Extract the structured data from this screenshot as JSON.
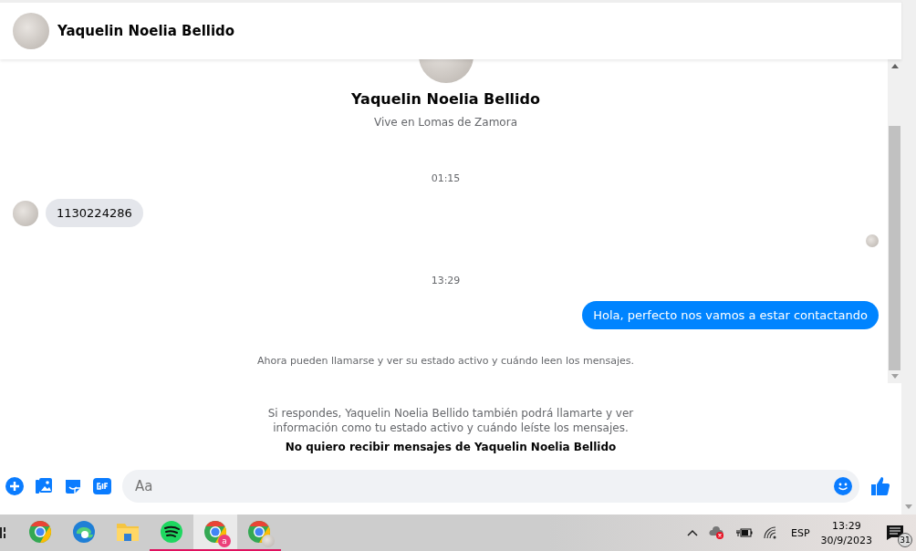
{
  "header": {
    "contact_name": "Yaquelin Noelia Bellido"
  },
  "profile": {
    "name": "Yaquelin Noelia Bellido",
    "subtitle": "Vive en Lomas de Zamora"
  },
  "messages": [
    {
      "kind": "time",
      "text": "01:15"
    },
    {
      "kind": "incoming",
      "text": "1130224286"
    },
    {
      "kind": "receipt"
    },
    {
      "kind": "time",
      "text": "13:29"
    },
    {
      "kind": "outgoing",
      "text": "Hola, perfecto nos vamos a estar contactando"
    },
    {
      "kind": "notice",
      "text": "Ahora pueden llamarse y ver su estado activo y cuándo leen los mensajes."
    }
  ],
  "request": {
    "text": "Si respondes, Yaquelin Noelia Bellido también podrá llamarte y ver información como tu estado activo y cuándo leíste los mensajes.",
    "link": "No quiero recibir mensajes de Yaquelin Noelia Bellido"
  },
  "composer": {
    "placeholder": "Aa"
  },
  "taskbar": {
    "apps": [
      {
        "kind": "chrome",
        "running": false,
        "selected": false
      },
      {
        "kind": "edge",
        "running": false,
        "selected": false
      },
      {
        "kind": "folder",
        "running": false,
        "selected": false
      },
      {
        "kind": "spotify",
        "running": true,
        "selected": false
      },
      {
        "kind": "chrome-badge",
        "badge": "a",
        "running": true,
        "selected": true
      },
      {
        "kind": "chrome-avatar",
        "running": true,
        "selected": false
      }
    ],
    "language": "ESP",
    "time": "13:29",
    "date": "30/9/2023",
    "notifications": "31"
  }
}
